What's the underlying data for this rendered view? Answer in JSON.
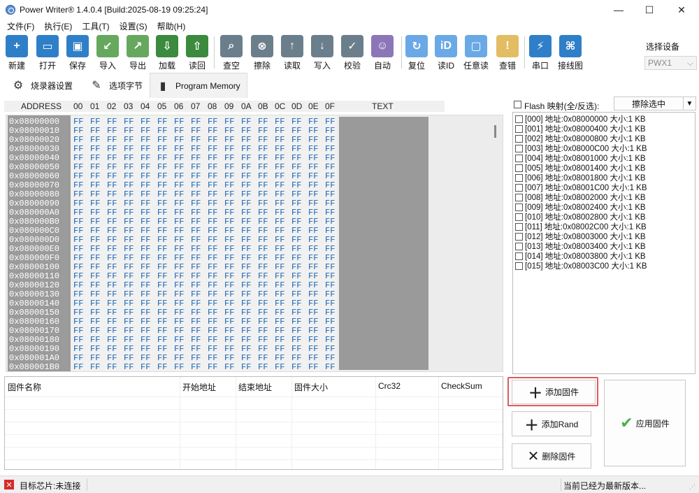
{
  "window": {
    "title": "Power Writer® 1.4.0.4 [Build:2025-08-19 09:25:24]",
    "controls": {
      "minimize": "—",
      "maximize": "☐",
      "close": "✕"
    }
  },
  "menu": [
    "文件(F)",
    "执行(E)",
    "工具(T)",
    "设置(S)",
    "帮助(H)"
  ],
  "toolbar": [
    {
      "label": "新建",
      "icon": "new-icon",
      "glyph": "+",
      "color": "blue"
    },
    {
      "label": "打开",
      "icon": "open-folder-icon",
      "glyph": "▭",
      "color": "blue"
    },
    {
      "label": "保存",
      "icon": "save-icon",
      "glyph": "▣",
      "color": "blue"
    },
    {
      "label": "导入",
      "icon": "import-icon",
      "glyph": "↙",
      "color": "green"
    },
    {
      "label": "导出",
      "icon": "export-icon",
      "glyph": "↗",
      "color": "green"
    },
    {
      "label": "加载",
      "icon": "load-icon",
      "glyph": "⇩",
      "color": "dkgreen"
    },
    {
      "label": "读回",
      "icon": "readback-icon",
      "glyph": "⇧",
      "color": "dkgreen"
    },
    {
      "label": "查空",
      "icon": "blank-check-icon",
      "glyph": "⌕",
      "color": "gray"
    },
    {
      "label": "擦除",
      "icon": "erase-icon",
      "glyph": "⊗",
      "color": "gray"
    },
    {
      "label": "读取",
      "icon": "read-icon",
      "glyph": "↑",
      "color": "gray"
    },
    {
      "label": "写入",
      "icon": "write-icon",
      "glyph": "↓",
      "color": "gray"
    },
    {
      "label": "校验",
      "icon": "verify-icon",
      "glyph": "✓",
      "color": "gray"
    },
    {
      "label": "自动",
      "icon": "robot-icon",
      "glyph": "☺",
      "color": "purple"
    },
    {
      "label": "复位",
      "icon": "reset-icon",
      "glyph": "↻",
      "color": "ltblue"
    },
    {
      "label": "读ID",
      "icon": "id-icon",
      "glyph": "iD",
      "color": "ltblue"
    },
    {
      "label": "任意读",
      "icon": "arbitrary-read-icon",
      "glyph": "▢",
      "color": "ltblue"
    },
    {
      "label": "查错",
      "icon": "error-check-icon",
      "glyph": "!",
      "color": "ochre"
    },
    {
      "label": "串口",
      "icon": "serial-port-icon",
      "glyph": "⚡",
      "color": "blue"
    },
    {
      "label": "接线图",
      "icon": "wiring-diagram-icon",
      "glyph": "⌘",
      "color": "blue"
    }
  ],
  "device": {
    "label": "选择设备",
    "selected": "PWX1"
  },
  "tabs": [
    {
      "label": "烧录器设置",
      "icon": "gear-icon",
      "glyph": "⚙"
    },
    {
      "label": "选项字节",
      "icon": "option-bytes-icon",
      "glyph": "✎"
    },
    {
      "label": "Program Memory",
      "icon": "memory-card-icon",
      "glyph": "▮"
    }
  ],
  "hex": {
    "header": {
      "address": "ADDRESS",
      "columns": [
        "00",
        "01",
        "02",
        "03",
        "04",
        "05",
        "06",
        "07",
        "08",
        "09",
        "0A",
        "0B",
        "0C",
        "0D",
        "0E",
        "0F"
      ],
      "text": "TEXT"
    },
    "addresses": [
      "0x08000000",
      "0x08000010",
      "0x08000020",
      "0x08000030",
      "0x08000040",
      "0x08000050",
      "0x08000060",
      "0x08000070",
      "0x08000080",
      "0x08000090",
      "0x080000A0",
      "0x080000B0",
      "0x080000C0",
      "0x080000D0",
      "0x080000E0",
      "0x080000F0",
      "0x08000100",
      "0x08000110",
      "0x08000120",
      "0x08000130",
      "0x08000140",
      "0x08000150",
      "0x08000160",
      "0x08000170",
      "0x08000180",
      "0x08000190",
      "0x080001A0",
      "0x080001B0"
    ],
    "fill": "FF"
  },
  "flash": {
    "label": "Flash 映射(全/反选):",
    "erase_button": "擦除选中",
    "sectors": [
      "[000] 地址:0x08000000 大小:1 KB",
      "[001] 地址:0x08000400 大小:1 KB",
      "[002] 地址:0x08000800 大小:1 KB",
      "[003] 地址:0x08000C00 大小:1 KB",
      "[004] 地址:0x08001000 大小:1 KB",
      "[005] 地址:0x08001400 大小:1 KB",
      "[006] 地址:0x08001800 大小:1 KB",
      "[007] 地址:0x08001C00 大小:1 KB",
      "[008] 地址:0x08002000 大小:1 KB",
      "[009] 地址:0x08002400 大小:1 KB",
      "[010] 地址:0x08002800 大小:1 KB",
      "[011] 地址:0x08002C00 大小:1 KB",
      "[012] 地址:0x08003000 大小:1 KB",
      "[013] 地址:0x08003400 大小:1 KB",
      "[014] 地址:0x08003800 大小:1 KB",
      "[015] 地址:0x08003C00 大小:1 KB"
    ]
  },
  "firmware": {
    "columns": [
      "固件名称",
      "开始地址",
      "结束地址",
      "固件大小",
      "Crc32",
      "CheckSum"
    ]
  },
  "actions": {
    "add_firmware": "添加固件",
    "add_rand": "添加Rand",
    "delete_firmware": "删除固件",
    "apply_firmware": "应用固件"
  },
  "status": {
    "chip": "目标芯片:未连接",
    "version": "当前已经为最新版本..."
  }
}
